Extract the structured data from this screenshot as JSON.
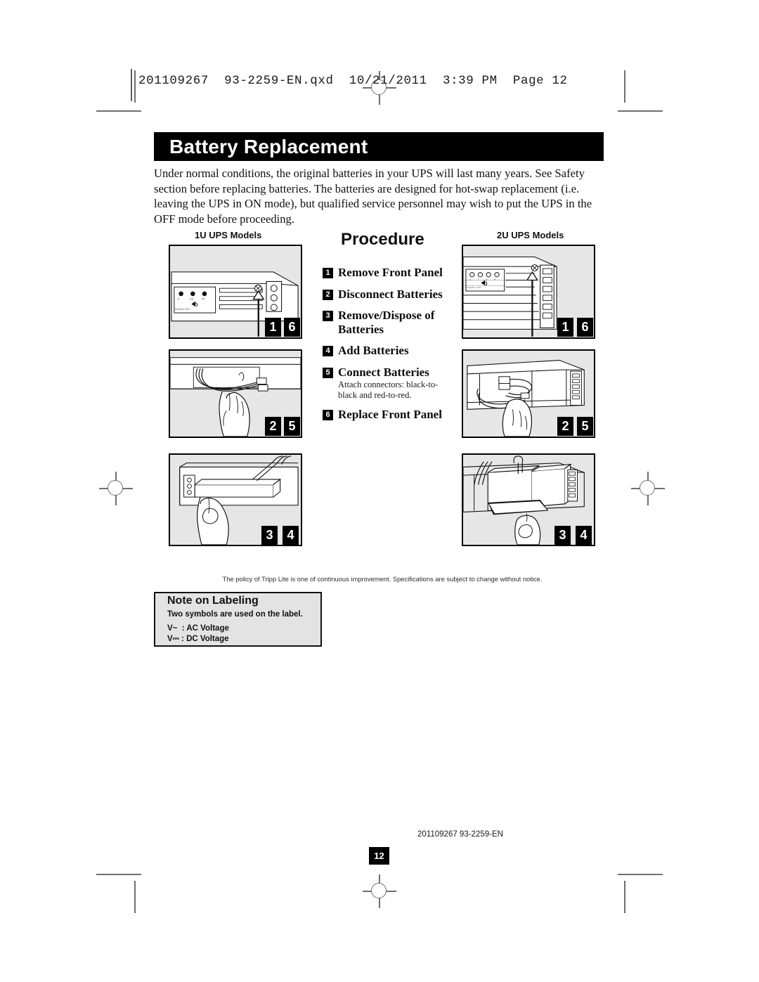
{
  "print_slug": "201109267  93-2259-EN.qxd  10/21/2011  3:39 PM  Page 12",
  "header": {
    "title": "Battery Replacement"
  },
  "intro": "Under normal conditions, the original batteries in your UPS will last many years. See Safety section before replacing batteries. The batteries are designed for hot-swap replacement (i.e. leaving the UPS in ON mode), but qualified service personnel may wish to put the UPS in the OFF mode before proceeding.",
  "columns": {
    "left_label": "1U UPS Models",
    "right_label": "2U UPS Models"
  },
  "procedure": {
    "heading": "Procedure",
    "steps": [
      {
        "num": "1",
        "label": "Remove Front Panel",
        "sub": ""
      },
      {
        "num": "2",
        "label": "Disconnect Batteries",
        "sub": ""
      },
      {
        "num": "3",
        "label": "Remove/Dispose of Batteries",
        "sub": ""
      },
      {
        "num": "4",
        "label": "Add Batteries",
        "sub": ""
      },
      {
        "num": "5",
        "label": "Connect Batteries",
        "sub": "Attach connectors: black-to-black and red-to-red."
      },
      {
        "num": "6",
        "label": "Replace Front Panel",
        "sub": ""
      }
    ]
  },
  "panels": {
    "left": [
      {
        "badges": [
          "1",
          "6"
        ],
        "caption": "front panel removal 1U"
      },
      {
        "badges": [
          "2",
          "5"
        ],
        "caption": "battery connectors 1U"
      },
      {
        "badges": [
          "3",
          "4"
        ],
        "caption": "battery pack removal 1U"
      }
    ],
    "right": [
      {
        "badges": [
          "1",
          "6"
        ],
        "caption": "front panel removal 2U"
      },
      {
        "badges": [
          "2",
          "5"
        ],
        "caption": "battery connectors 2U"
      },
      {
        "badges": [
          "3",
          "4"
        ],
        "caption": "battery pack removal 2U"
      }
    ]
  },
  "policy_note": "The policy of Tripp Lite is one of continuous improvement. Specifications are subject to change without notice.",
  "note_box": {
    "title": "Note on Labeling",
    "subtitle": "Two symbols are used on the label.",
    "ac_line": "V~  : AC Voltage",
    "dc_line": "V⎓ : DC Voltage"
  },
  "footer": {
    "code": "201109267 93-2259-EN",
    "page_number": "12"
  }
}
